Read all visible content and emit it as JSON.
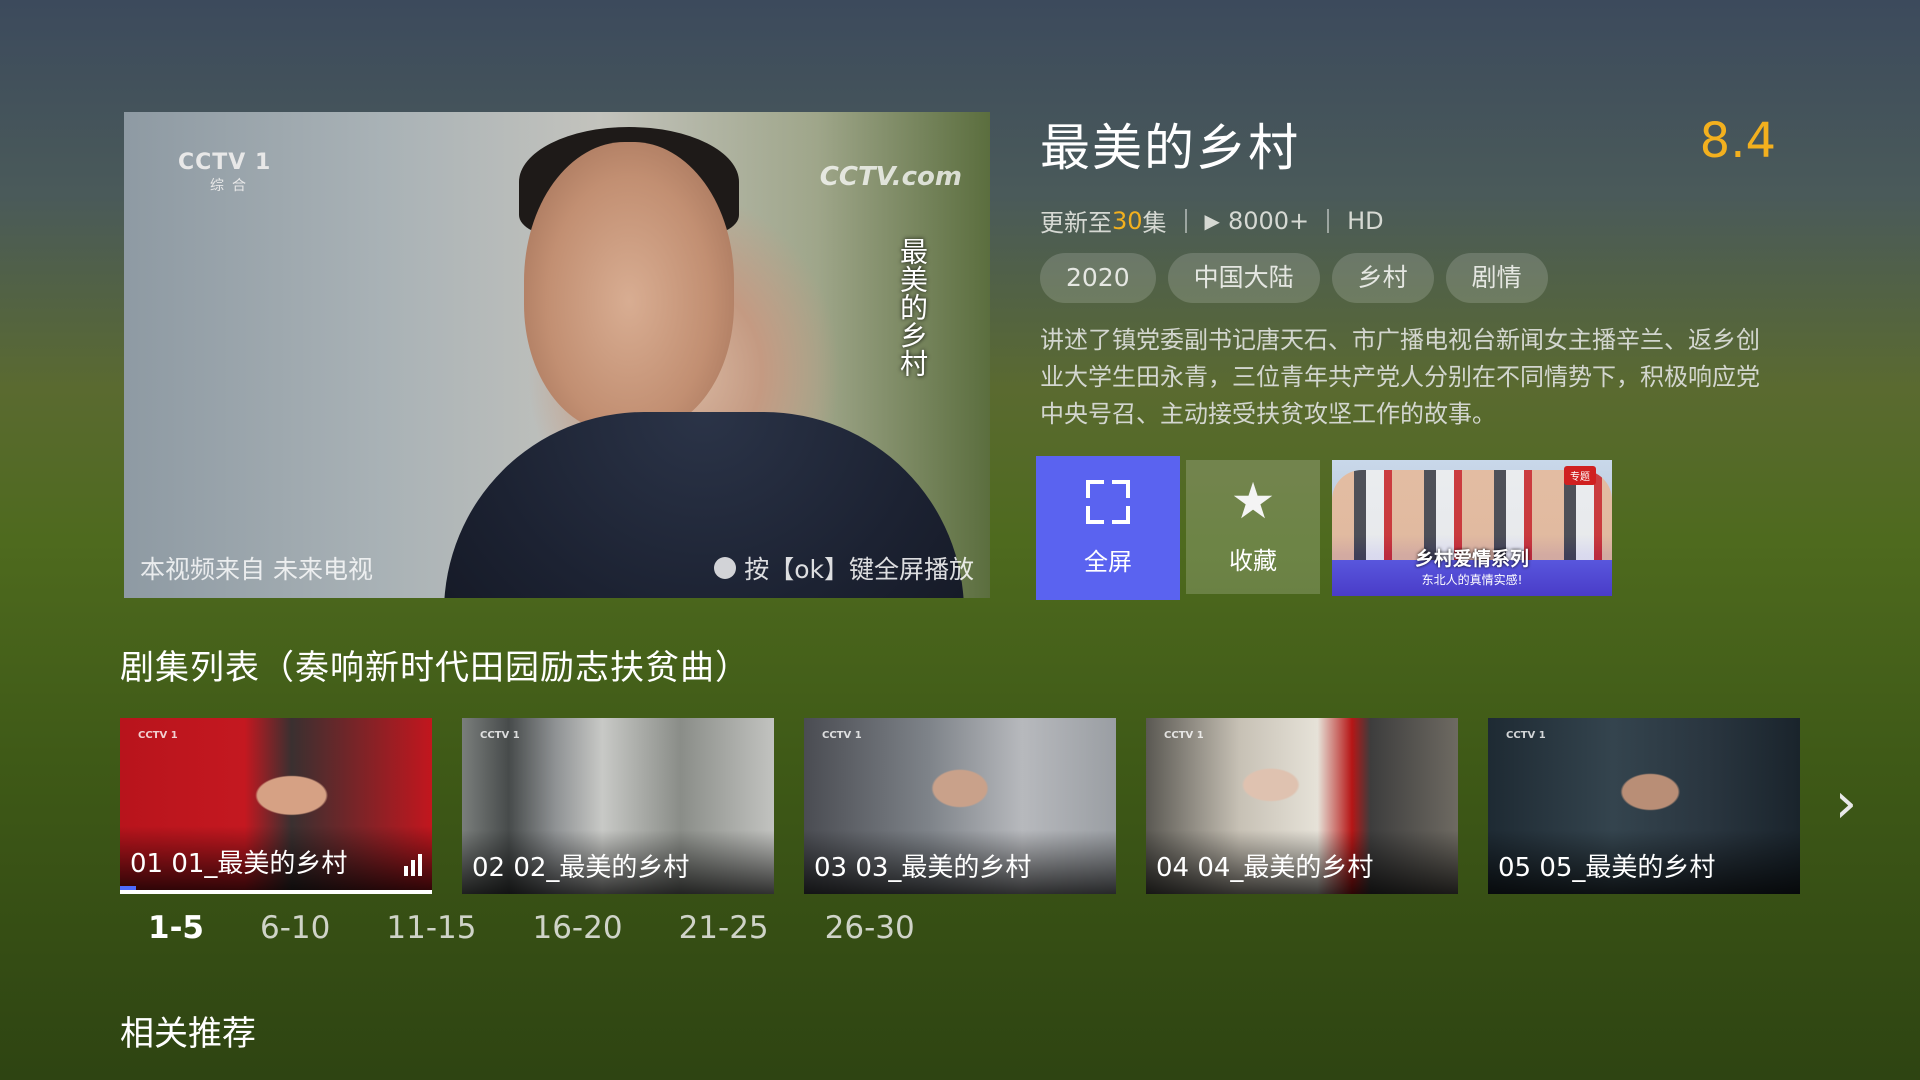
{
  "player": {
    "channel_logo": "CCTV 1",
    "channel_sub": "综合",
    "watermark": "CCTV.com",
    "vertical_title": "最美的乡村",
    "source_text": "本视频来自 未来电视",
    "hint_text": "按【ok】键全屏播放"
  },
  "show": {
    "title": "最美的乡村",
    "score": "8.4",
    "update_prefix": "更新至",
    "update_count": "30",
    "update_suffix": "集",
    "play_count": "8000+",
    "quality": "HD",
    "tags": [
      "2020",
      "中国大陆",
      "乡村",
      "剧情"
    ],
    "description": "讲述了镇党委副书记唐天石、市广播电视台新闻女主播辛兰、返乡创业大学生田永青，三位青年共产党人分别在不同情势下，积极响应党中央号召、主动接受扶贫攻坚工作的故事。"
  },
  "actions": {
    "fullscreen_label": "全屏",
    "favorite_label": "收藏",
    "promo_title": "乡村爱情系列",
    "promo_subtitle": "东北人的真情实感!",
    "promo_badge": "专题"
  },
  "episodes": {
    "section_title": "剧集列表（奏响新时代田园励志扶贫曲）",
    "items": [
      {
        "label": "01 01_最美的乡村"
      },
      {
        "label": "02 02_最美的乡村"
      },
      {
        "label": "03 03_最美的乡村"
      },
      {
        "label": "04 04_最美的乡村"
      },
      {
        "label": "05 05_最美的乡村"
      }
    ],
    "ranges": [
      "1-5",
      "6-10",
      "11-15",
      "16-20",
      "21-25",
      "26-30"
    ],
    "active_range": "1-5"
  },
  "related": {
    "title": "相关推荐"
  },
  "colors": {
    "accent": "#5a63f0",
    "score": "#f3b01e"
  }
}
